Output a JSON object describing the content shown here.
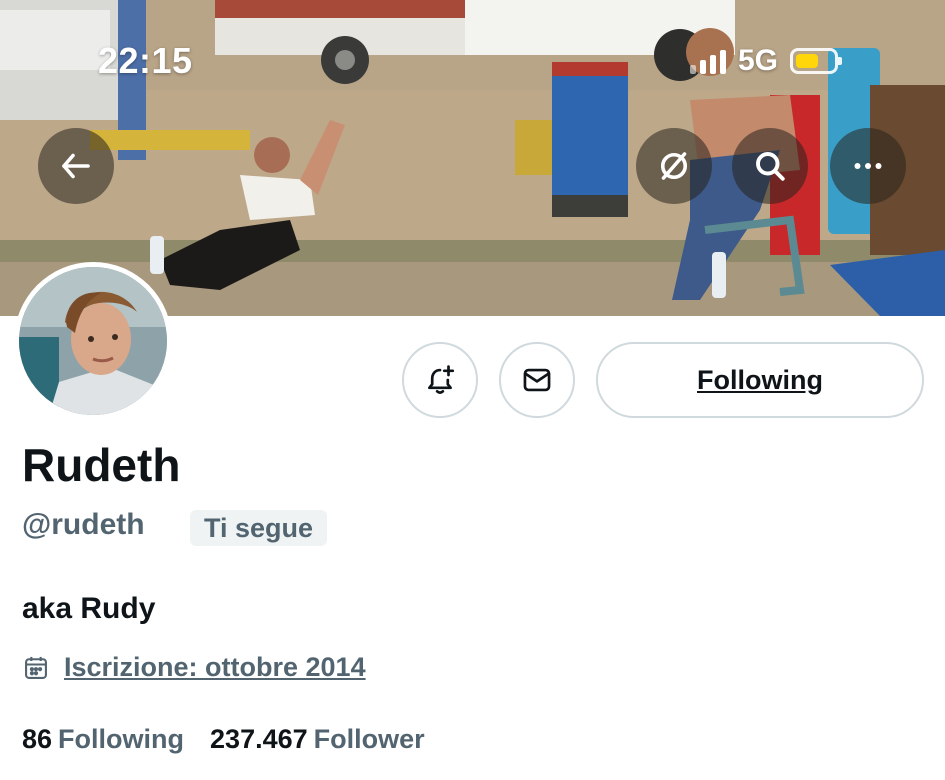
{
  "status_bar": {
    "time": "22:15",
    "network": "5G",
    "battery_color": "#ffd60a"
  },
  "header_actions": {
    "back_icon": "arrow-left-icon",
    "grok_icon": "slash-circle-icon",
    "search_icon": "search-icon",
    "more_icon": "more-horizontal-icon"
  },
  "profile_actions": {
    "notify_icon": "bell-plus-icon",
    "message_icon": "envelope-icon",
    "follow_label": "Following"
  },
  "profile": {
    "display_name": "Rudeth",
    "handle": "@rudeth",
    "follows_you": "Ti segue",
    "bio": "aka Rudy",
    "joined": "Iscrizione: ottobre 2014",
    "joined_icon": "calendar-icon"
  },
  "stats": {
    "following_count": "86",
    "following_label": "Following",
    "followers_count": "237.467",
    "followers_label": "Follower"
  },
  "colors": {
    "text_primary": "#0f1419",
    "text_secondary": "#536471",
    "border": "#cfd9de",
    "badge_bg": "#eff3f4"
  }
}
